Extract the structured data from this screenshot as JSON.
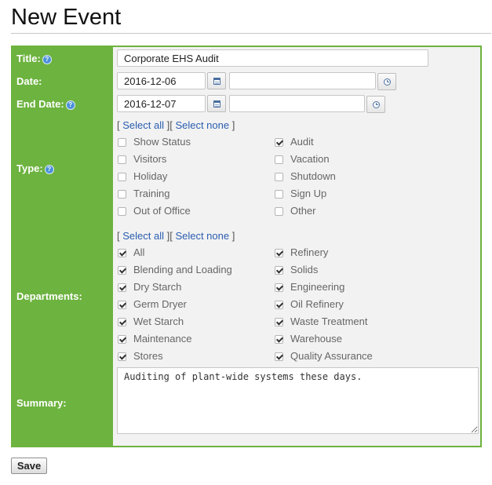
{
  "page": {
    "title": "New Event"
  },
  "form": {
    "title_label": "Title:",
    "title_value": "Corporate EHS Audit",
    "date_label": "Date:",
    "date_value": "2016-12-06",
    "date_time_value": "",
    "end_date_label": "End Date:",
    "end_date_value": "2016-12-07",
    "end_time_value": "",
    "type_label": "Type:",
    "departments_label": "Departments:",
    "summary_label": "Summary:",
    "summary_value": "Auditing of plant-wide systems these days.",
    "select_all": "Select all",
    "select_none": "Select none",
    "types": [
      {
        "label": "Show Status",
        "checked": false
      },
      {
        "label": "Audit",
        "checked": true
      },
      {
        "label": "Visitors",
        "checked": false
      },
      {
        "label": "Vacation",
        "checked": false
      },
      {
        "label": "Holiday",
        "checked": false
      },
      {
        "label": "Shutdown",
        "checked": false
      },
      {
        "label": "Training",
        "checked": false
      },
      {
        "label": "Sign Up",
        "checked": false
      },
      {
        "label": "Out of Office",
        "checked": false
      },
      {
        "label": "Other",
        "checked": false
      }
    ],
    "departments": [
      {
        "label": "All",
        "checked": true
      },
      {
        "label": "Refinery",
        "checked": true
      },
      {
        "label": "Blending and Loading",
        "checked": true
      },
      {
        "label": "Solids",
        "checked": true
      },
      {
        "label": "Dry Starch",
        "checked": true
      },
      {
        "label": "Engineering",
        "checked": true
      },
      {
        "label": "Germ Dryer",
        "checked": true
      },
      {
        "label": "Oil Refinery",
        "checked": true
      },
      {
        "label": "Wet Starch",
        "checked": true
      },
      {
        "label": "Waste Treatment",
        "checked": true
      },
      {
        "label": "Maintenance",
        "checked": true
      },
      {
        "label": "Warehouse",
        "checked": true
      },
      {
        "label": "Stores",
        "checked": true
      },
      {
        "label": "Quality Assurance",
        "checked": true
      }
    ]
  },
  "actions": {
    "save_label": "Save"
  },
  "colors": {
    "label_column": "#6db33f",
    "content_bg": "#f2f2f2",
    "link": "#2a5db0"
  },
  "icons": {
    "help": "help-icon",
    "calendar": "calendar-icon",
    "clock": "clock-icon"
  }
}
